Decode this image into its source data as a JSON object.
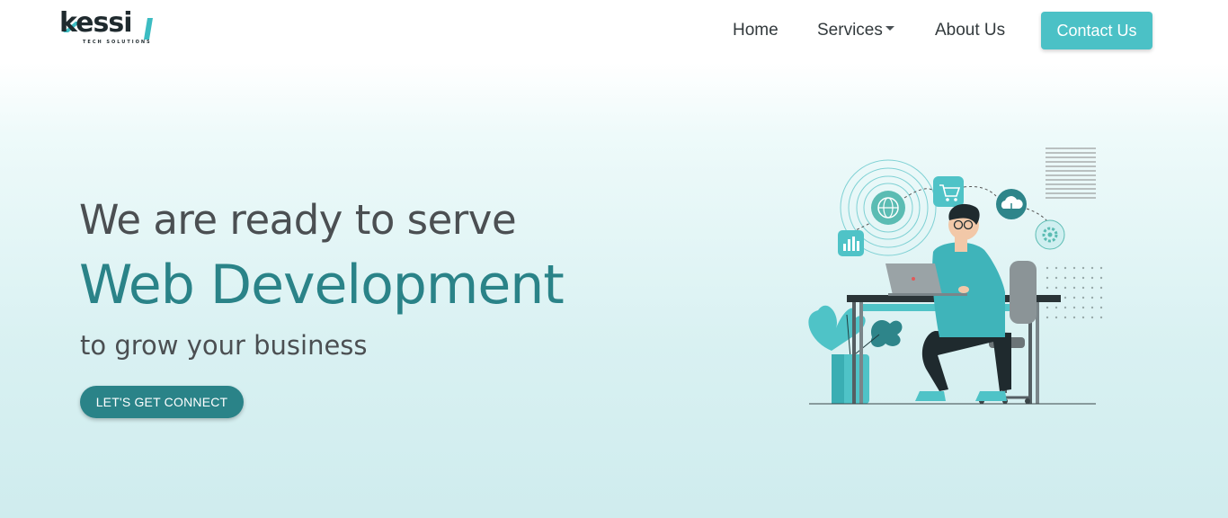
{
  "brand": {
    "logo_text": "kessi",
    "tagline": "TECH SOLUTIONS"
  },
  "nav": {
    "items": [
      {
        "label": "Home"
      },
      {
        "label": "Services",
        "has_dropdown": true
      },
      {
        "label": "About Us"
      }
    ],
    "contact_label": "Contact Us"
  },
  "hero": {
    "line1": "We are ready to serve",
    "highlight": "Web Development",
    "line3": "to grow your business",
    "cta_label": "LET'S GET CONNECT"
  },
  "colors": {
    "accent_teal": "#2a8388",
    "accent_light": "#4bc1c6",
    "text_dark": "#4b4f52"
  },
  "illustration": {
    "subject": "person-at-laptop-icon",
    "icons": [
      "globe-icon",
      "cart-icon",
      "cloud-upload-icon",
      "gear-icon",
      "bar-chart-icon",
      "plant-icon"
    ]
  }
}
